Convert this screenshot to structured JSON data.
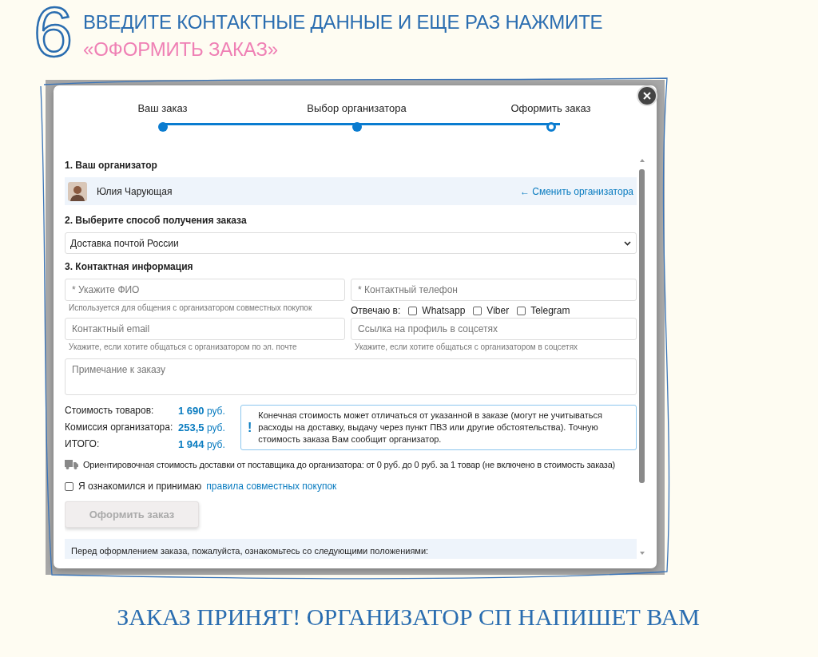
{
  "heading": {
    "step": "6",
    "line_1": "ВВЕДИТЕ КОНТАКТНЫЕ ДАННЫЕ И ЕЩЕ РАЗ НАЖМИТЕ",
    "line_2": "«ОФОРМИТЬ ЗАКАЗ»"
  },
  "modal": {
    "steps": [
      {
        "label": "Ваш заказ",
        "kind": "done"
      },
      {
        "label": "Выбор организатора",
        "kind": "done"
      },
      {
        "label": "Оформить заказ",
        "kind": "current"
      }
    ],
    "organizer": {
      "title": "1. Ваш организатор",
      "name": "Юлия Чарующая",
      "change_link": "← Сменить организатора"
    },
    "delivery": {
      "title": "2. Выберите способ получения заказа",
      "value": "Доставка почтой России"
    },
    "contact": {
      "title": "3. Контактная информация",
      "name_field": {
        "placeholder": "* Укажите ФИО",
        "hint": "Используется для общения с организатором совместных покупок"
      },
      "phone_field": {
        "placeholder": "* Контактный телефон"
      },
      "reply_label": "Отвечаю в:",
      "messengers": [
        {
          "label": "Whatsapp",
          "checked": false
        },
        {
          "label": "Viber",
          "checked": false
        },
        {
          "label": "Telegram",
          "checked": false
        }
      ],
      "email_field": {
        "placeholder": "Контактный email",
        "hint": "Укажите, если хотите общаться с организатором по эл. почте"
      },
      "social_field": {
        "placeholder": "Ссылка на профиль в соцсетях",
        "hint": "Укажите, если хотите общаться с организатором в соцсетях"
      },
      "note_field": {
        "placeholder": "Примечание к заказу"
      }
    },
    "totals": [
      {
        "label": "Стоимость товаров:",
        "amount": "1 690",
        "unit": "руб."
      },
      {
        "label": "Комиссия организатора:",
        "amount": "253,5",
        "unit": "руб."
      },
      {
        "label": "ИТОГО:",
        "amount": "1 944",
        "unit": "руб."
      }
    ],
    "notice": {
      "mark": "!",
      "text": "Конечная стоимость может отличаться от указанной в заказе (могут не учитываться расходы на доставку, выдачу через пункт ПВЗ или другие обстоятельства). Точную стоимость заказа Вам сообщит организатор."
    },
    "shipping_note": "Ориентировочная стоимость доставки от поставщика до организатора: от 0 руб. до 0 руб. за 1 товар (не включено в стоимость заказа)",
    "agreement": {
      "checked": false,
      "text": "Я ознакомился и принимаю",
      "link": "правила совместных покупок"
    },
    "submit": {
      "label": "Оформить заказ",
      "disabled": true
    },
    "rules_box": "Перед оформлением заказа, пожалуйста, ознакомьтесь со следующими положениями:"
  },
  "caption": "ЗАКАЗ ПРИНЯТ! ОРГАНИЗАТОР СП НАПИШЕТ ВАМ"
}
